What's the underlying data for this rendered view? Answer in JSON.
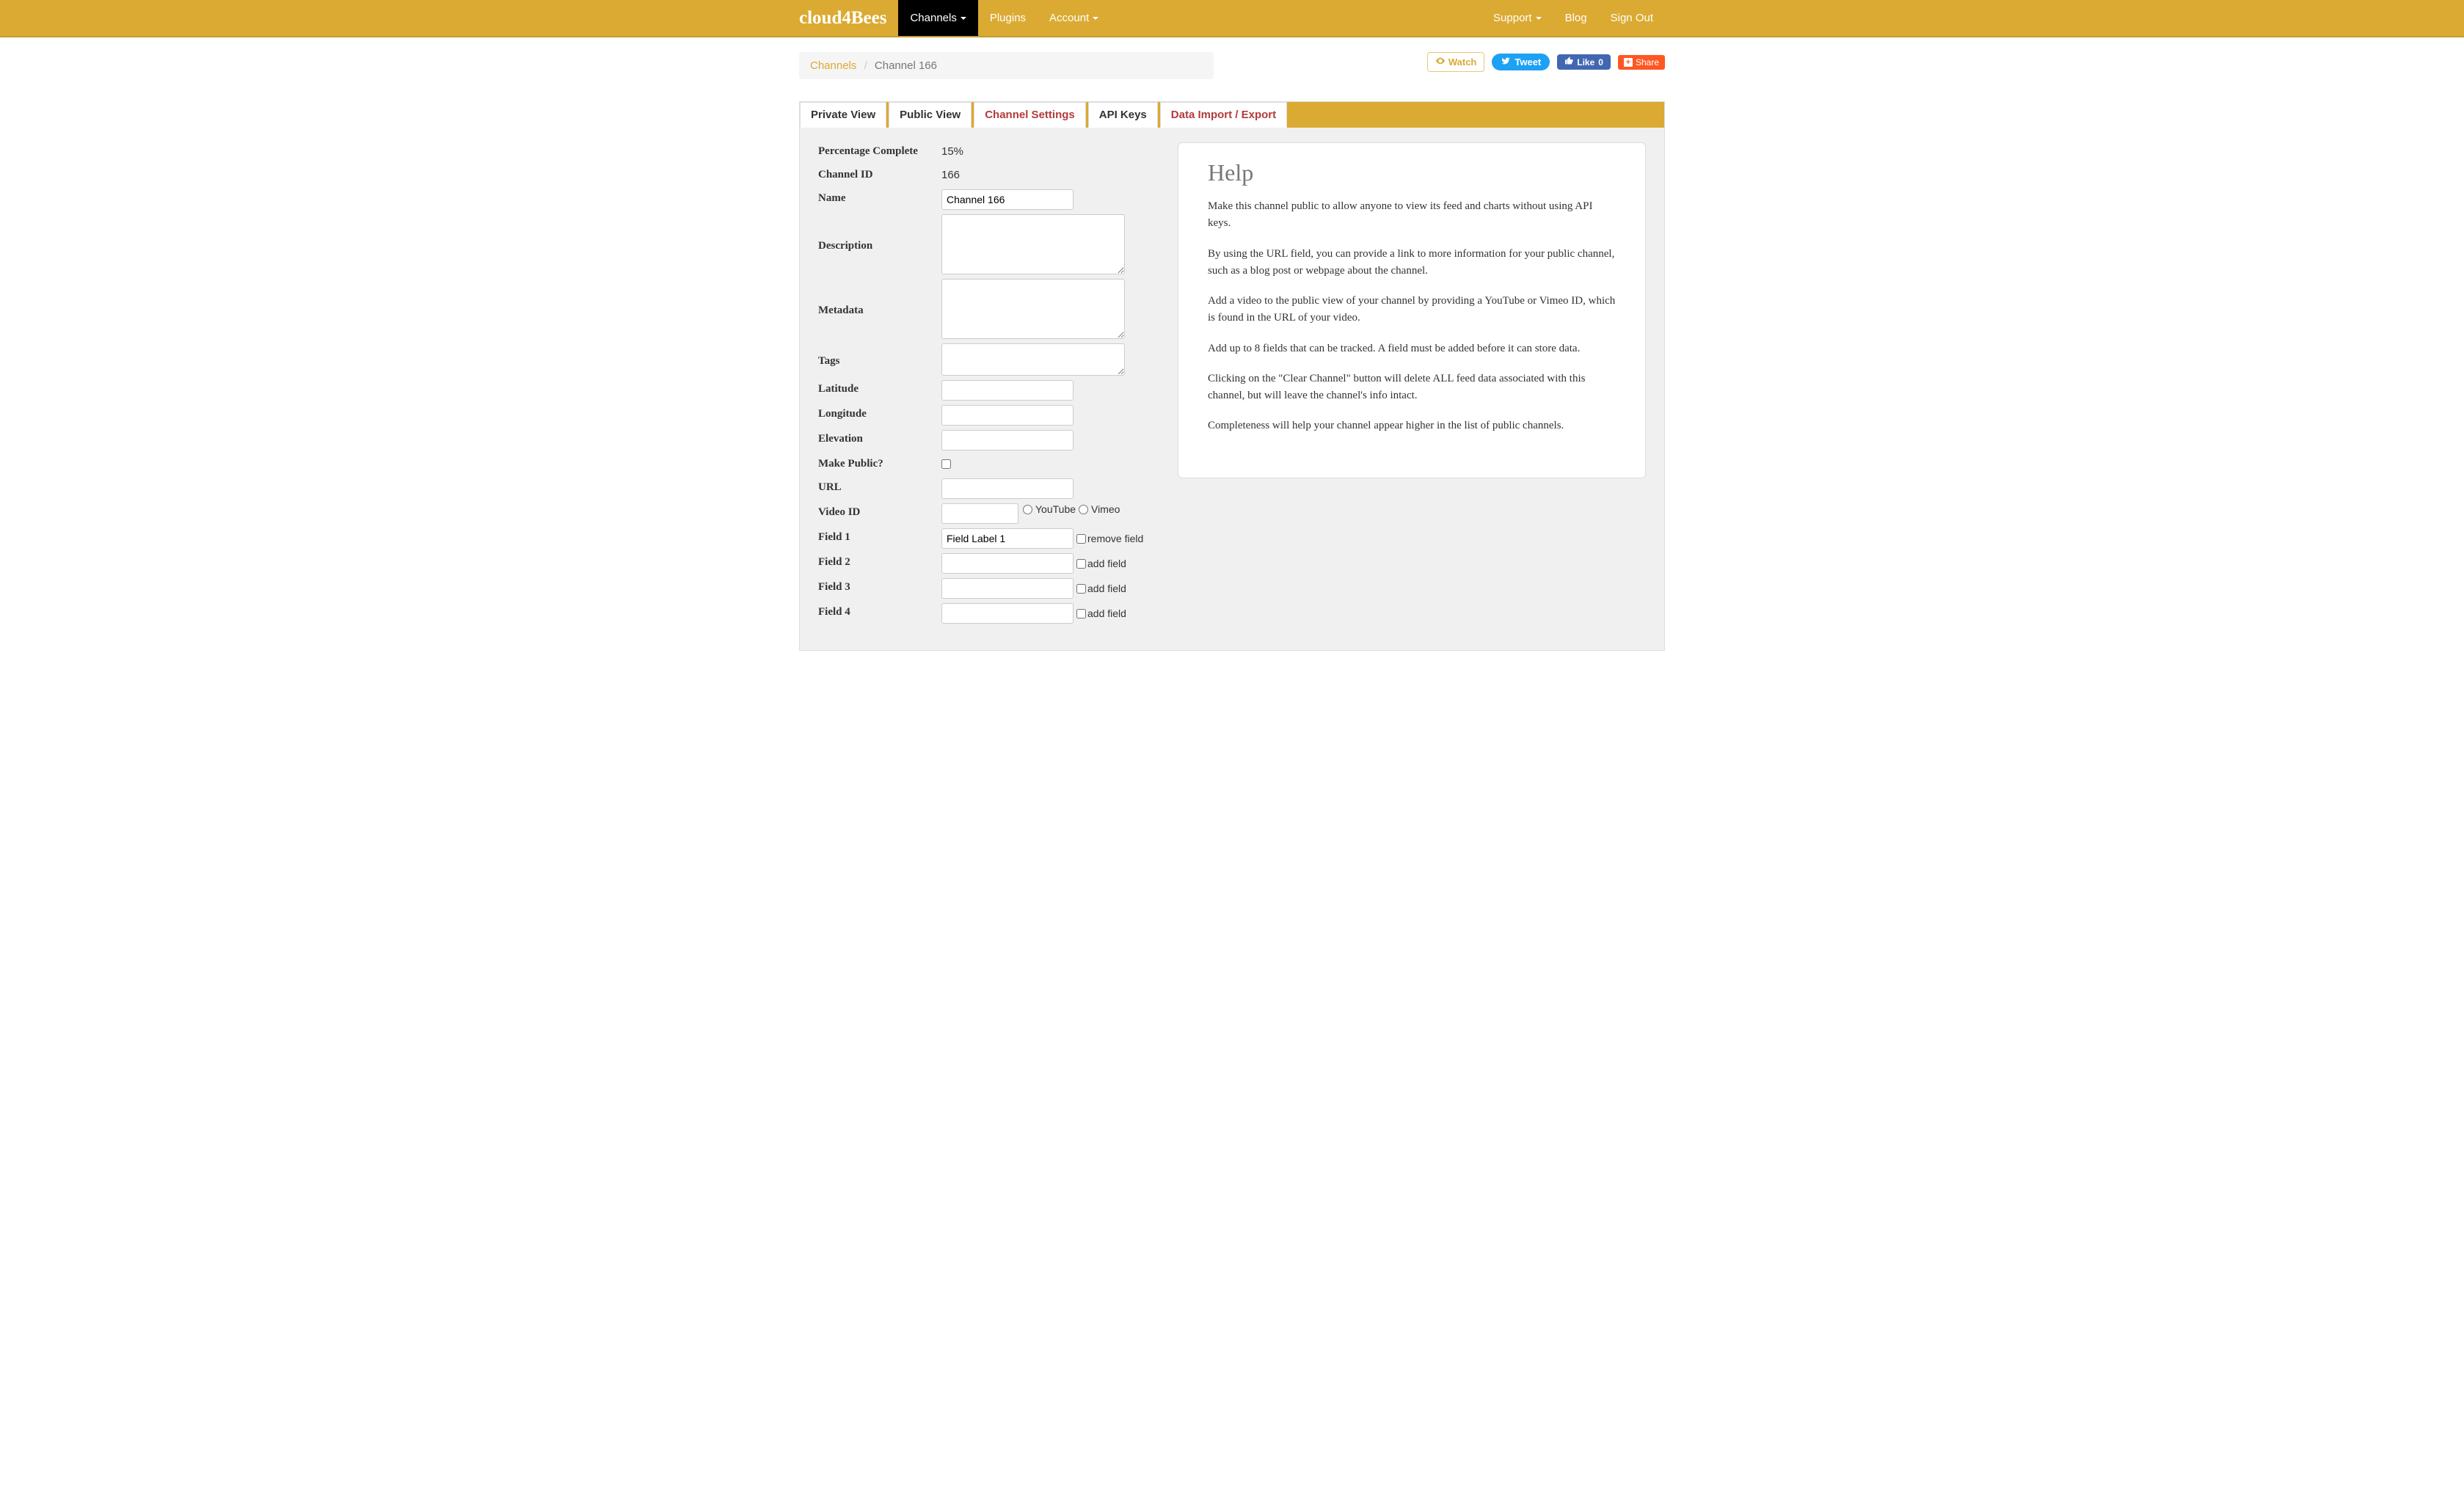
{
  "brand": "cloud4Bees",
  "nav": {
    "channels": "Channels",
    "plugins": "Plugins",
    "account": "Account",
    "support": "Support",
    "blog": "Blog",
    "signout": "Sign Out"
  },
  "breadcrumb": {
    "root": "Channels",
    "current": "Channel 166"
  },
  "social": {
    "watch": "Watch",
    "tweet": "Tweet",
    "like": "Like",
    "like_count": "0",
    "share": "Share"
  },
  "tabs": {
    "private": "Private View",
    "public": "Public View",
    "settings": "Channel Settings",
    "apikeys": "API Keys",
    "import": "Data Import / Export"
  },
  "form": {
    "percentage_label": "Percentage Complete",
    "percentage_value": "15%",
    "channel_id_label": "Channel ID",
    "channel_id_value": "166",
    "name_label": "Name",
    "name_value": "Channel 166",
    "description_label": "Description",
    "description_value": "",
    "metadata_label": "Metadata",
    "metadata_value": "",
    "tags_label": "Tags",
    "tags_value": "",
    "latitude_label": "Latitude",
    "latitude_value": "",
    "longitude_label": "Longitude",
    "longitude_value": "",
    "elevation_label": "Elevation",
    "elevation_value": "",
    "make_public_label": "Make Public?",
    "url_label": "URL",
    "url_value": "",
    "video_id_label": "Video ID",
    "video_id_value": "",
    "video_youtube": "YouTube",
    "video_vimeo": "Vimeo",
    "field1_label": "Field 1",
    "field1_value": "Field Label 1",
    "remove_field": "remove field",
    "field2_label": "Field 2",
    "field2_value": "",
    "field3_label": "Field 3",
    "field3_value": "",
    "field4_label": "Field 4",
    "field4_value": "",
    "add_field": "add field"
  },
  "help": {
    "title": "Help",
    "p1": "Make this channel public to allow anyone to view its feed and charts without using API keys.",
    "p2": "By using the URL field, you can provide a link to more information for your public channel, such as a blog post or webpage about the channel.",
    "p3": "Add a video to the public view of your channel by providing a YouTube or Vimeo ID, which is found in the URL of your video.",
    "p4": "Add up to 8 fields that can be tracked. A field must be added before it can store data.",
    "p5": "Clicking on the \"Clear Channel\" button will delete ALL feed data associated with this channel, but will leave the channel's info intact.",
    "p6": "Completeness will help your channel appear higher in the list of public channels."
  }
}
